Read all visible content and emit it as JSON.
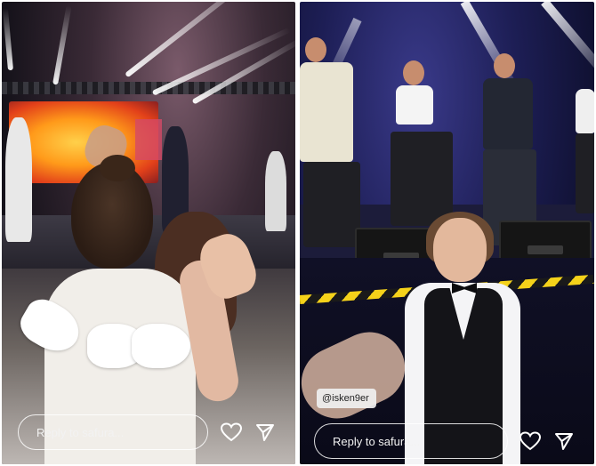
{
  "stories": [
    {
      "reply_placeholder": "Reply to safura..."
    },
    {
      "reply_placeholder": "Reply to safura...",
      "mention_sticker": "@isken9er"
    }
  ],
  "icons": {
    "like": "heart-icon",
    "share": "send-icon"
  },
  "colors": {
    "left_stage_screen": "#ff9a1a",
    "right_stage_light": "#1d1e55",
    "caution_tape": "#f5d21a"
  }
}
